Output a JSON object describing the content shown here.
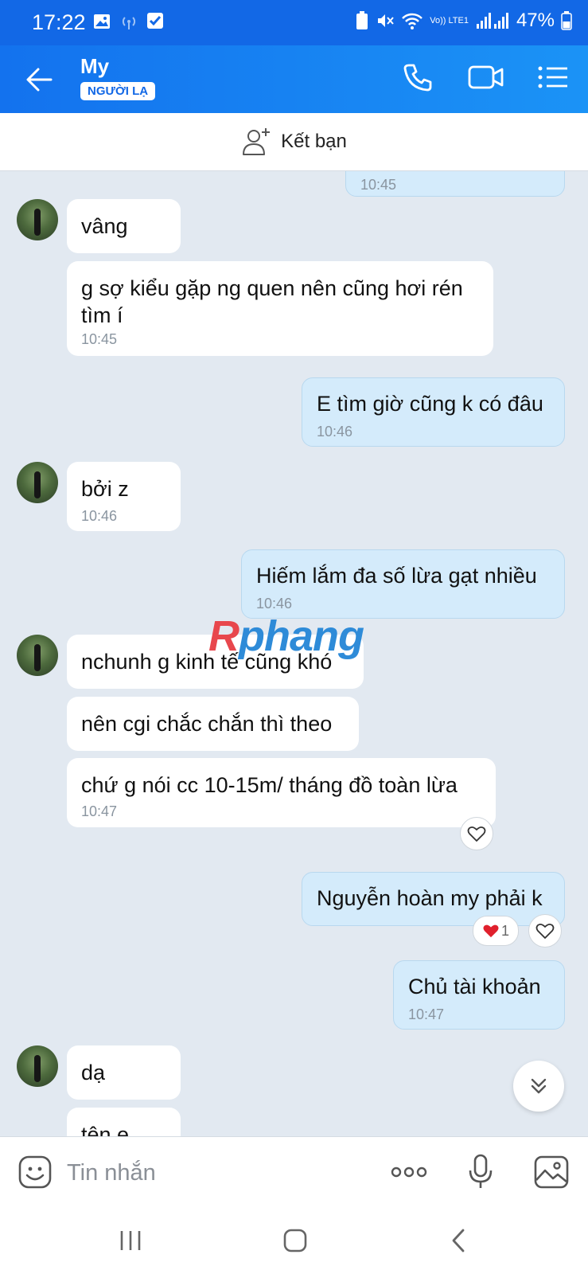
{
  "status_bar": {
    "time": "17:22",
    "network": "Vo)) LTE1",
    "battery": "47%"
  },
  "header": {
    "name": "My",
    "badge": "NGƯỜI LẠ"
  },
  "add_friend": {
    "label": "Kết bạn"
  },
  "partial_top_time": "10:45",
  "messages": [
    {
      "dir": "in",
      "text": "vâng",
      "time": ""
    },
    {
      "dir": "in",
      "text": "g sợ kiểu gặp ng quen nên cũng hơi rén tìm í",
      "time": "10:45"
    },
    {
      "dir": "out",
      "text": "E tìm giờ cũng k có đâu",
      "time": "10:46"
    },
    {
      "dir": "in",
      "text": "bởi z",
      "time": "10:46"
    },
    {
      "dir": "out",
      "text": "Hiếm lắm đa số lừa gạt nhiều",
      "time": "10:46"
    },
    {
      "dir": "in",
      "text": "nchunh g kinh tế cũng khó",
      "time": ""
    },
    {
      "dir": "in",
      "text": "nên cgi chắc chắn thì theo",
      "time": ""
    },
    {
      "dir": "in",
      "text": "chứ g nói cc 10-15m/ tháng đồ toàn lừa",
      "time": "10:47"
    },
    {
      "dir": "out",
      "text": "Nguyễn hoàn my phải k",
      "time": "",
      "reaction_count": "1"
    },
    {
      "dir": "out",
      "text": "Chủ tài khoản",
      "time": "10:47"
    },
    {
      "dir": "in",
      "text": "dạ",
      "time": ""
    },
    {
      "dir": "in",
      "text": "tên e",
      "time": ""
    }
  ],
  "watermark": {
    "part1": "R",
    "part2": "phang"
  },
  "input": {
    "placeholder": "Tin nhắn"
  },
  "colors": {
    "header": "#1372ee",
    "outgoing_bubble": "#d4ebfb",
    "incoming_bubble": "#ffffff",
    "background": "#e2e9f1"
  },
  "icons": [
    "back-arrow-icon",
    "phone-icon",
    "video-call-icon",
    "menu-list-icon",
    "add-friend-icon",
    "heart-icon",
    "red-heart-icon",
    "scroll-down-icon",
    "sticker-icon",
    "more-icon",
    "mic-icon",
    "image-icon"
  ]
}
